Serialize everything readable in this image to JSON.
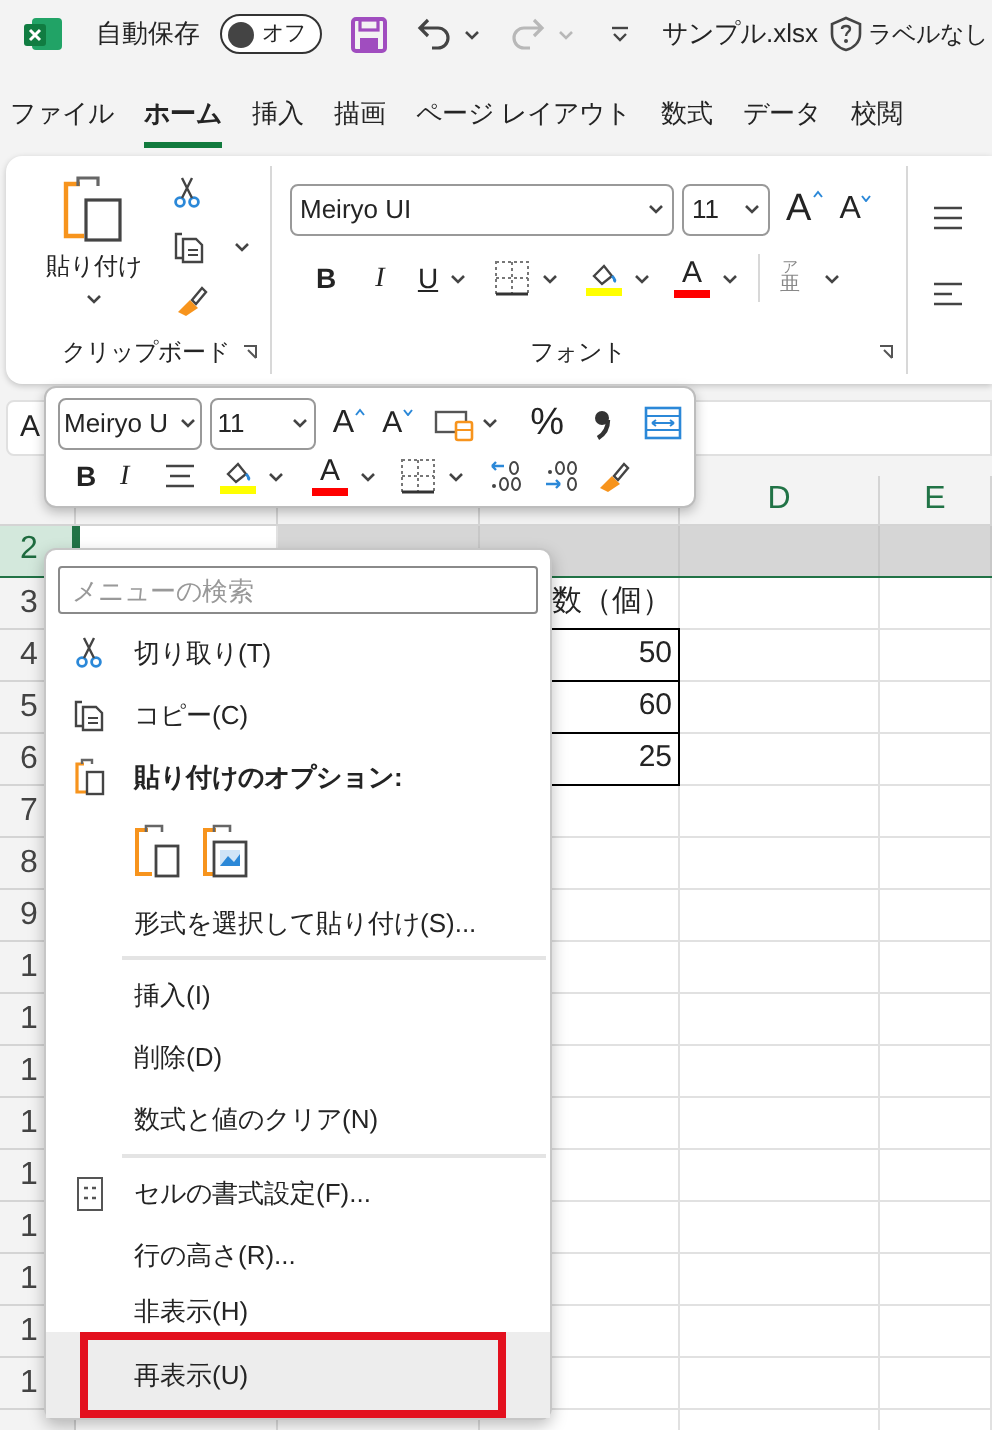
{
  "title_bar": {
    "autosave_label": "自動保存",
    "autosave": {
      "label": "オフ",
      "on": false
    },
    "redo_disabled": true,
    "file_name": "サンプル.xlsx",
    "sensitivity": "ラベルなし"
  },
  "tabs": [
    {
      "label": "ファイル",
      "selected": false
    },
    {
      "label": "ホーム",
      "selected": true
    },
    {
      "label": "挿入",
      "selected": false
    },
    {
      "label": "描画",
      "selected": false
    },
    {
      "label": "ページ レイアウト",
      "selected": false
    },
    {
      "label": "数式",
      "selected": false
    },
    {
      "label": "データ",
      "selected": false
    },
    {
      "label": "校閲",
      "selected": false
    }
  ],
  "ribbon": {
    "paste_label": "貼り付け",
    "clipboard_label": "クリップボード",
    "font_name": "Meiryo UI",
    "font_size": "11",
    "grow_glyph": "A",
    "shrink_glyph": "A",
    "bold": "B",
    "italic": "I",
    "underline": "U",
    "font_color_glyph": "A",
    "phonetic": [
      "ア",
      "亜"
    ],
    "font_label": "フォント"
  },
  "name_box": "A",
  "mini_toolbar": {
    "font_name": "Meiryo U",
    "font_size": "11",
    "grow_glyph": "A",
    "shrink_glyph": "A",
    "percent": "%",
    "bold": "B",
    "italic": "I",
    "font_color_glyph": "A"
  },
  "sheet": {
    "column_headers": [
      "D",
      "E"
    ],
    "rows": [
      {
        "header": "2",
        "selected": true,
        "bordered": false
      },
      {
        "header": "3",
        "selected": false,
        "bordered": false,
        "value": "数（個）"
      },
      {
        "header": "4",
        "selected": false,
        "bordered": true,
        "value": "50"
      },
      {
        "header": "5",
        "selected": false,
        "bordered": true,
        "value": "60"
      },
      {
        "header": "6",
        "selected": false,
        "bordered": true,
        "value": "25"
      },
      {
        "header": "7",
        "selected": false,
        "bordered": false
      },
      {
        "header": "8",
        "selected": false,
        "bordered": false
      },
      {
        "header": "9",
        "selected": false,
        "bordered": false
      },
      {
        "header": "1",
        "selected": false,
        "bordered": false
      },
      {
        "header": "1",
        "selected": false,
        "bordered": false
      },
      {
        "header": "1",
        "selected": false,
        "bordered": false
      },
      {
        "header": "1",
        "selected": false,
        "bordered": false
      },
      {
        "header": "1",
        "selected": false,
        "bordered": false
      },
      {
        "header": "1",
        "selected": false,
        "bordered": false
      },
      {
        "header": "1",
        "selected": false,
        "bordered": false
      },
      {
        "header": "1",
        "selected": false,
        "bordered": false
      },
      {
        "header": "1",
        "selected": false,
        "bordered": false
      }
    ]
  },
  "context_menu": {
    "search_placeholder": "メニューの検索",
    "items": [
      {
        "kind": "command",
        "label": "切り取り(T)",
        "highlighted": false,
        "marked": false
      },
      {
        "kind": "command",
        "label": "コピー(C)",
        "highlighted": false,
        "marked": false
      },
      {
        "kind": "heading",
        "label": "貼り付けのオプション:"
      },
      {
        "kind": "paste_options"
      },
      {
        "kind": "command",
        "label": "形式を選択して貼り付け(S)...",
        "highlighted": false,
        "marked": false
      },
      {
        "kind": "separator"
      },
      {
        "kind": "command",
        "label": "挿入(I)",
        "highlighted": false,
        "marked": false
      },
      {
        "kind": "command",
        "label": "削除(D)",
        "highlighted": false,
        "marked": false
      },
      {
        "kind": "command",
        "label": "数式と値のクリア(N)",
        "highlighted": false,
        "marked": false
      },
      {
        "kind": "separator"
      },
      {
        "kind": "command",
        "label": "セルの書式設定(F)...",
        "highlighted": false,
        "marked": false
      },
      {
        "kind": "command",
        "label": "行の高さ(R)...",
        "highlighted": false,
        "marked": false
      },
      {
        "kind": "command",
        "label": "非表示(H)",
        "highlighted": false,
        "marked": false
      },
      {
        "kind": "command",
        "label": "再表示(U)",
        "highlighted": true,
        "marked": true
      }
    ]
  }
}
